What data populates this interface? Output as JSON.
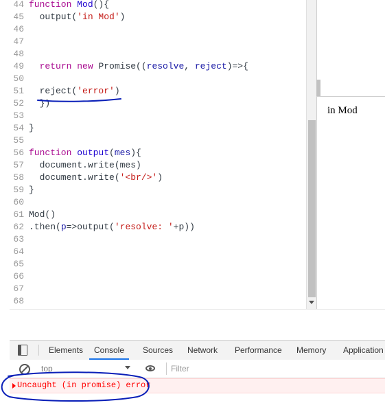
{
  "editor": {
    "lines": [
      {
        "num": "44",
        "tokens": [
          {
            "c": "kw",
            "t": "function "
          },
          {
            "c": "fn",
            "t": "Mod"
          },
          {
            "c": "",
            "t": "(){"
          }
        ]
      },
      {
        "num": "45",
        "tokens": [
          {
            "c": "",
            "t": "  output("
          },
          {
            "c": "str",
            "t": "'in Mod'"
          },
          {
            "c": "",
            "t": ")"
          }
        ]
      },
      {
        "num": "46",
        "tokens": []
      },
      {
        "num": "47",
        "tokens": []
      },
      {
        "num": "48",
        "tokens": []
      },
      {
        "num": "49",
        "tokens": [
          {
            "c": "",
            "t": "  "
          },
          {
            "c": "kw",
            "t": "return new "
          },
          {
            "c": "",
            "t": "Promise(("
          },
          {
            "c": "var",
            "t": "resolve"
          },
          {
            "c": "",
            "t": ", "
          },
          {
            "c": "var",
            "t": "reject"
          },
          {
            "c": "",
            "t": ")=>{"
          }
        ]
      },
      {
        "num": "50",
        "tokens": []
      },
      {
        "num": "51",
        "tokens": [
          {
            "c": "",
            "t": "  reject("
          },
          {
            "c": "str",
            "t": "'error'"
          },
          {
            "c": "",
            "t": ")"
          }
        ]
      },
      {
        "num": "52",
        "tokens": [
          {
            "c": "",
            "t": "  })"
          }
        ]
      },
      {
        "num": "53",
        "tokens": []
      },
      {
        "num": "54",
        "tokens": [
          {
            "c": "",
            "t": "}"
          }
        ]
      },
      {
        "num": "55",
        "tokens": []
      },
      {
        "num": "56",
        "tokens": [
          {
            "c": "kw",
            "t": "function "
          },
          {
            "c": "fn",
            "t": "output"
          },
          {
            "c": "",
            "t": "("
          },
          {
            "c": "var",
            "t": "mes"
          },
          {
            "c": "",
            "t": "){"
          }
        ]
      },
      {
        "num": "57",
        "tokens": [
          {
            "c": "",
            "t": "  document.write(mes)"
          }
        ]
      },
      {
        "num": "58",
        "tokens": [
          {
            "c": "",
            "t": "  document.write("
          },
          {
            "c": "str",
            "t": "'<br/>'"
          },
          {
            "c": "",
            "t": ")"
          }
        ]
      },
      {
        "num": "59",
        "tokens": [
          {
            "c": "",
            "t": "}"
          }
        ]
      },
      {
        "num": "60",
        "tokens": []
      },
      {
        "num": "61",
        "tokens": [
          {
            "c": "",
            "t": "Mod()"
          }
        ]
      },
      {
        "num": "62",
        "tokens": [
          {
            "c": "",
            "t": ".then("
          },
          {
            "c": "var",
            "t": "p"
          },
          {
            "c": "",
            "t": "=>output("
          },
          {
            "c": "str",
            "t": "'resolve: '"
          },
          {
            "c": "",
            "t": "+p))"
          }
        ]
      },
      {
        "num": "63",
        "tokens": []
      },
      {
        "num": "64",
        "tokens": []
      },
      {
        "num": "65",
        "tokens": []
      },
      {
        "num": "66",
        "tokens": []
      },
      {
        "num": "67",
        "tokens": []
      },
      {
        "num": "68",
        "tokens": []
      }
    ]
  },
  "preview": {
    "text": "in Mod"
  },
  "devtools": {
    "tabs": [
      "Elements",
      "Console",
      "Sources",
      "Network",
      "Performance",
      "Memory",
      "Application"
    ],
    "active_tab": "Console",
    "context": "top",
    "filter_placeholder": "Filter",
    "error_message": "Uncaught (in promise) error"
  },
  "colors": {
    "annotation": "#0a1fb8",
    "error": "#ff0000",
    "active_tab_underline": "#1a73e8"
  }
}
